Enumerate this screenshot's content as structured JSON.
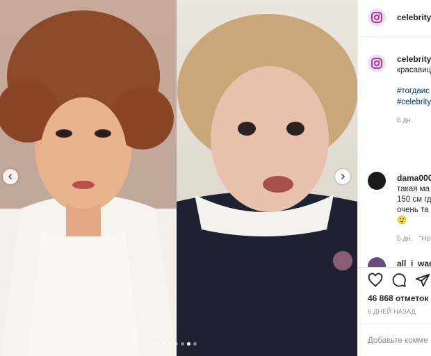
{
  "post": {
    "author": "celebrity_",
    "slide_dots_total": 7,
    "slide_dots_active": 5
  },
  "caption": {
    "username": "celebrity_",
    "text": "красавиц",
    "hashtags": [
      "#тогдаис",
      "#celebrity"
    ],
    "age": "6 дн."
  },
  "comment": {
    "username": "dama000",
    "lines": [
      "такая ма",
      "150 см гд",
      "очень та",
      "🙂"
    ],
    "age": "6 дн.",
    "reply_label": "\"Нр"
  },
  "next_comment_username": "all_i_wan",
  "actions": {
    "likes": "46 868 отметок \"",
    "posted": "6 ДНЕЙ НАЗАД"
  },
  "comment_input": {
    "placeholder": "Добавьте комме"
  }
}
